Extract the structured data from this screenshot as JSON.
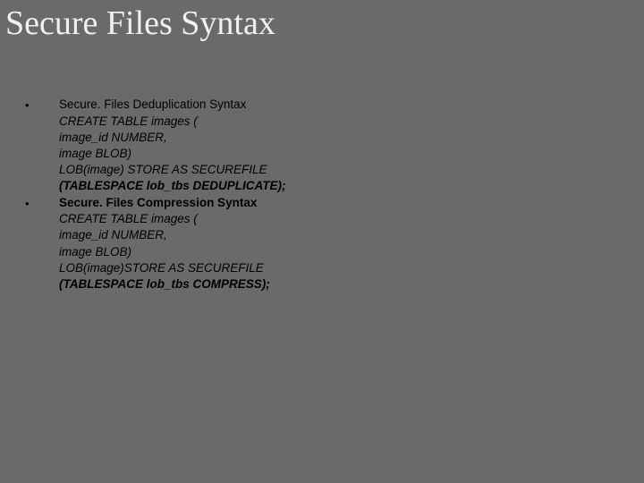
{
  "title": "Secure Files Syntax",
  "lines": [
    {
      "bullet": "•",
      "text": "Secure. Files Deduplication Syntax",
      "bold": false,
      "italic": false
    },
    {
      "bullet": "",
      "text": "CREATE TABLE images (",
      "bold": false,
      "italic": true
    },
    {
      "bullet": "",
      "text": "image_id NUMBER,",
      "bold": false,
      "italic": true
    },
    {
      "bullet": "",
      "text": "image BLOB)",
      "bold": false,
      "italic": true
    },
    {
      "bullet": "",
      "text": "LOB(image) STORE AS SECUREFILE",
      "bold": false,
      "italic": true
    },
    {
      "bullet": "",
      "text": "(TABLESPACE lob_tbs DEDUPLICATE);",
      "bold": true,
      "italic": true
    },
    {
      "bullet": "•",
      "text": "Secure. Files Compression Syntax",
      "bold": true,
      "italic": false
    },
    {
      "bullet": "",
      "text": "CREATE TABLE images (",
      "bold": false,
      "italic": true
    },
    {
      "bullet": "",
      "text": "image_id NUMBER,",
      "bold": false,
      "italic": true
    },
    {
      "bullet": "",
      "text": "image BLOB)",
      "bold": false,
      "italic": true
    },
    {
      "bullet": "",
      "text": "LOB(image)STORE AS SECUREFILE",
      "bold": false,
      "italic": true
    },
    {
      "bullet": "",
      "text": "(TABLESPACE lob_tbs COMPRESS);",
      "bold": true,
      "italic": true
    }
  ]
}
